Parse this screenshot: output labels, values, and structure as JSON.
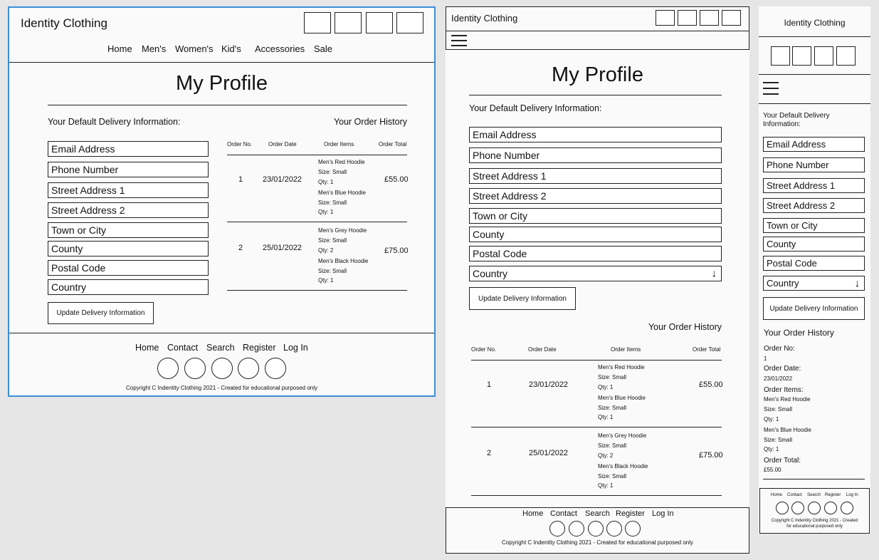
{
  "brand": "Identity Clothing",
  "nav": [
    "Home",
    "Men's",
    "Women's",
    "Kid's",
    "Accessories",
    "Sale"
  ],
  "page_title": "My Profile",
  "delivery_heading": "Your Default Delivery Information:",
  "order_history_heading": "Your Order History",
  "fields": [
    "Email Address",
    "Phone Number",
    "Street Address 1",
    "Street Address 2",
    "Town or City",
    "County",
    "Postal Code",
    "Country"
  ],
  "update_button": "Update Delivery Information",
  "table_headers": [
    "Order No.",
    "Order Date",
    "Order Items",
    "Order Total"
  ],
  "orders": [
    {
      "no": "1",
      "date": "23/01/2022",
      "total": "£55.00",
      "items": [
        [
          "Men's Red Hoodie",
          "Size: Small",
          "Qty: 1"
        ],
        [
          "Men's Blue Hoodie",
          "Size: Small",
          "Qty: 1"
        ]
      ]
    },
    {
      "no": "2",
      "date": "25/01/2022",
      "total": "£75.00",
      "items": [
        [
          "Men's Grey Hoodie",
          "Size: Small",
          "Qty: 2"
        ],
        [
          "Men's Black Hoodie",
          "Size: Small",
          "Qty: 1"
        ]
      ]
    }
  ],
  "mobile_order": {
    "no_label": "Order No:",
    "no": "1",
    "date_label": "Order Date:",
    "date": "23/01/2022",
    "items_label": "Order Items:",
    "items": [
      [
        "Men's Red Hoodie",
        "Size: Small",
        "Qty: 1"
      ],
      [
        "Men's Blue Hoodie",
        "Size: Small",
        "Qty: 1"
      ]
    ],
    "total_label": "Order Total:",
    "total": "£55.00"
  },
  "footer_links": [
    "Home",
    "Contact",
    "Search",
    "Register",
    "Log In"
  ],
  "copyright": "Copyright C Indentity Clothing 2021 - Created for educational purposed only",
  "mobile_copyright_line1": "Copyright C Indentity Clothing 2021 - Created",
  "mobile_copyright_line2": "for educational purposed only",
  "colors": {
    "selection": "#3b8fd9",
    "background": "#e6e6e6",
    "frame": "#fafafa",
    "ink": "#222222"
  }
}
